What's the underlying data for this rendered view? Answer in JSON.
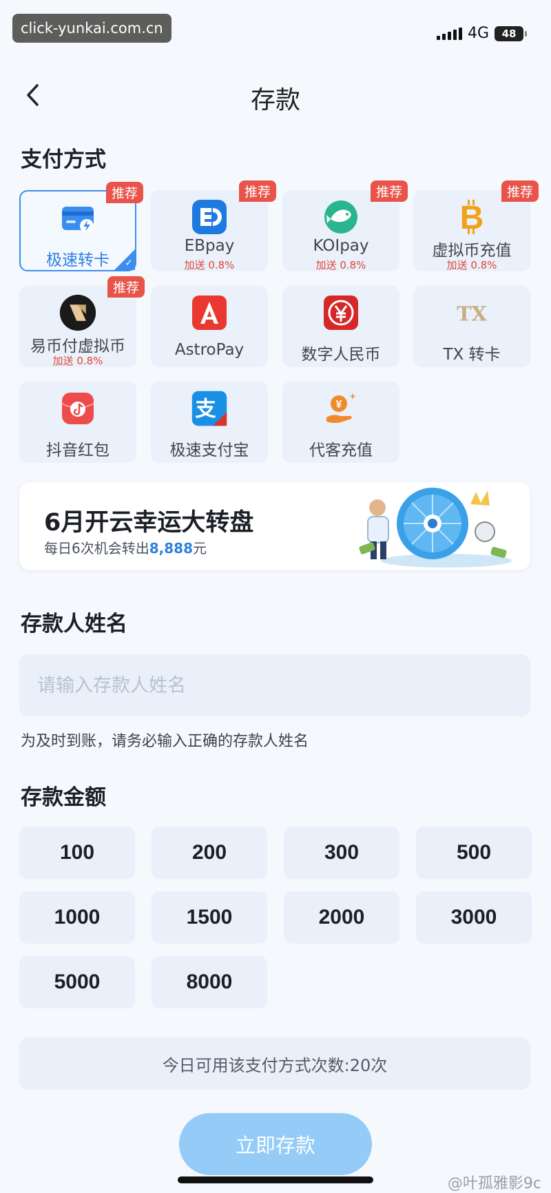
{
  "status": {
    "watermark_url": "click-yunkai.com.cn",
    "network": "4G",
    "battery": "48"
  },
  "header": {
    "title": "存款"
  },
  "payment": {
    "section_title": "支付方式",
    "badge_label": "推荐",
    "methods": [
      {
        "name": "极速转卡",
        "bonus": "",
        "recommended": true,
        "selected": true,
        "icon": "card-lightning-icon"
      },
      {
        "name": "EBpay",
        "bonus": "加送 0.8%",
        "recommended": true,
        "selected": false,
        "icon": "ebpay-logo-icon"
      },
      {
        "name": "KOIpay",
        "bonus": "加送 0.8%",
        "recommended": true,
        "selected": false,
        "icon": "koi-fish-icon"
      },
      {
        "name": "虚拟币充值",
        "bonus": "加送 0.8%",
        "recommended": true,
        "selected": false,
        "icon": "bitcoin-icon"
      },
      {
        "name": "易币付虚拟币",
        "bonus": "加送 0.8%",
        "recommended": true,
        "selected": false,
        "icon": "yibifu-logo-icon"
      },
      {
        "name": "AstroPay",
        "bonus": "",
        "recommended": false,
        "selected": false,
        "icon": "astropay-logo-icon"
      },
      {
        "name": "数字人民币",
        "bonus": "",
        "recommended": false,
        "selected": false,
        "icon": "digital-yuan-icon"
      },
      {
        "name": "TX 转卡",
        "bonus": "",
        "recommended": false,
        "selected": false,
        "icon": "tx-logo-icon"
      },
      {
        "name": "抖音红包",
        "bonus": "",
        "recommended": false,
        "selected": false,
        "icon": "douyin-redpacket-icon"
      },
      {
        "name": "极速支付宝",
        "bonus": "",
        "recommended": false,
        "selected": false,
        "icon": "alipay-icon"
      },
      {
        "name": "代客充值",
        "bonus": "",
        "recommended": false,
        "selected": false,
        "icon": "agent-recharge-icon"
      }
    ]
  },
  "banner": {
    "title": "6月开云幸运大转盘",
    "subtitle_prefix": "每日6次机会转出",
    "subtitle_amount": "8,888",
    "subtitle_suffix": "元"
  },
  "depositor": {
    "section_title": "存款人姓名",
    "placeholder": "请输入存款人姓名",
    "value": "",
    "hint": "为及时到账，请务必输入正确的存款人姓名"
  },
  "amount": {
    "section_title": "存款金额",
    "options": [
      "100",
      "200",
      "300",
      "500",
      "1000",
      "1500",
      "2000",
      "3000",
      "5000",
      "8000"
    ]
  },
  "usage_text": "今日可用该支付方式次数:20次",
  "submit_label": "立即存款",
  "corner_watermark": "@叶孤雅影9c",
  "colors": {
    "accent": "#3b8df0",
    "badge": "#e8534a",
    "submit": "#94cbf7",
    "bonus": "#e0453a"
  }
}
